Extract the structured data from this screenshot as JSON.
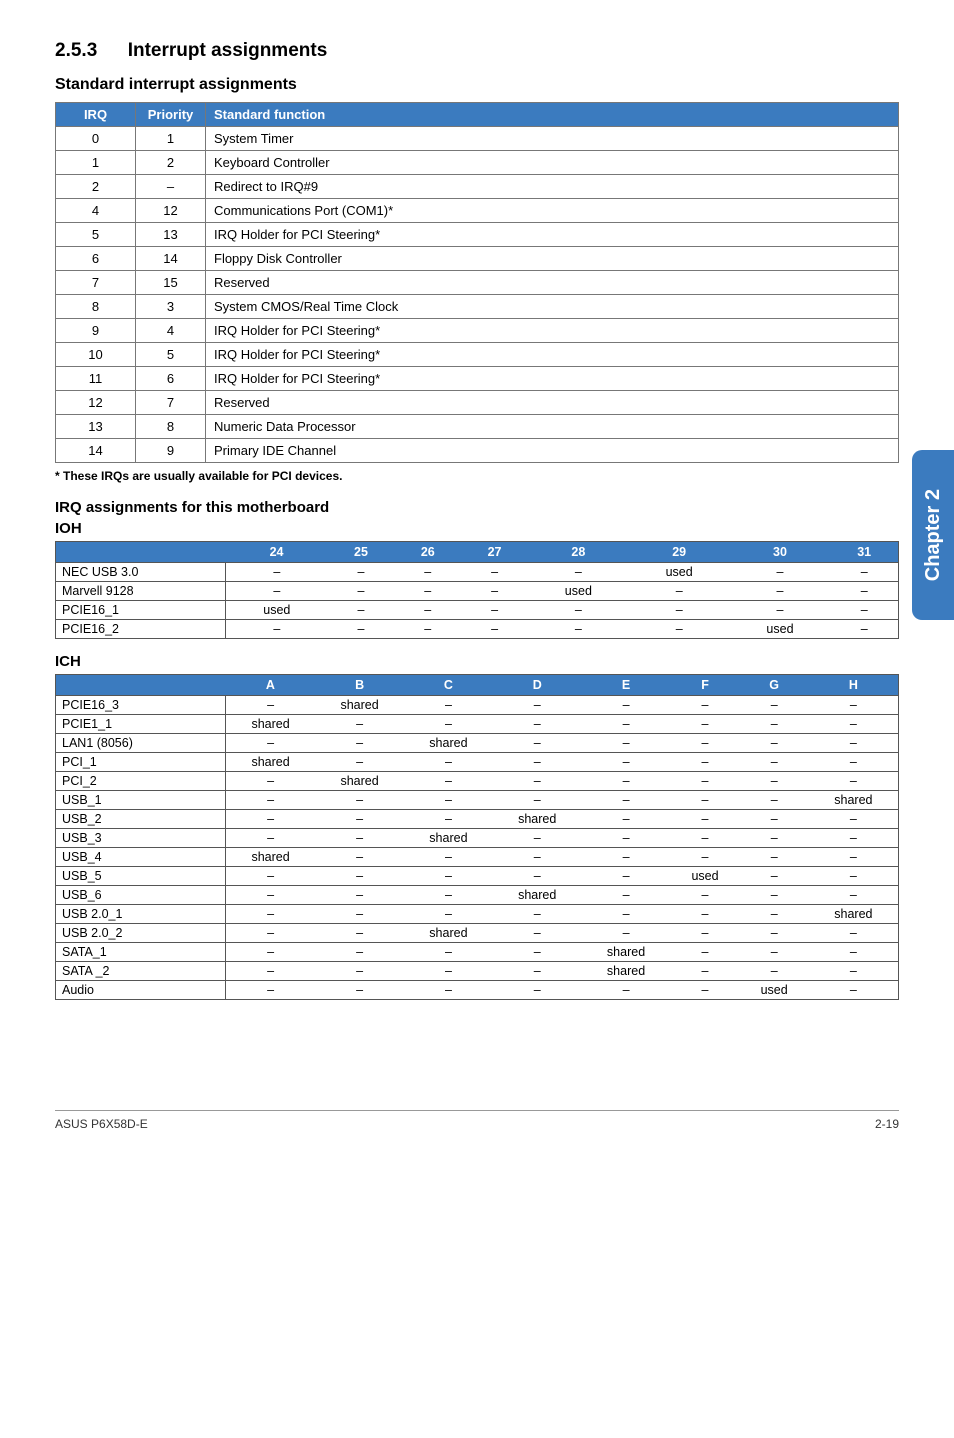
{
  "section": {
    "num": "2.5.3",
    "title": "Interrupt assignments"
  },
  "sub_standard": "Standard interrupt assignments",
  "irq_headers": {
    "c1": "IRQ",
    "c2": "Priority",
    "c3": "Standard function"
  },
  "irq_rows": [
    {
      "irq": "0",
      "pri": "1",
      "func": "System Timer"
    },
    {
      "irq": "1",
      "pri": "2",
      "func": "Keyboard Controller"
    },
    {
      "irq": "2",
      "pri": "–",
      "func": "Redirect to IRQ#9"
    },
    {
      "irq": "4",
      "pri": "12",
      "func": "Communications Port (COM1)*"
    },
    {
      "irq": "5",
      "pri": "13",
      "func": "IRQ Holder for PCI Steering*"
    },
    {
      "irq": "6",
      "pri": "14",
      "func": "Floppy Disk Controller"
    },
    {
      "irq": "7",
      "pri": "15",
      "func": "Reserved"
    },
    {
      "irq": "8",
      "pri": "3",
      "func": "System CMOS/Real Time Clock"
    },
    {
      "irq": "9",
      "pri": "4",
      "func": "IRQ Holder for PCI Steering*"
    },
    {
      "irq": "10",
      "pri": "5",
      "func": "IRQ Holder for PCI Steering*"
    },
    {
      "irq": "11",
      "pri": "6",
      "func": "IRQ Holder for PCI Steering*"
    },
    {
      "irq": "12",
      "pri": "7",
      "func": "Reserved"
    },
    {
      "irq": "13",
      "pri": "8",
      "func": "Numeric Data Processor"
    },
    {
      "irq": "14",
      "pri": "9",
      "func": "Primary IDE Channel"
    }
  ],
  "footnote": "* These IRQs are usually available for PCI devices.",
  "sub_irq_assign": "IRQ assignments for this motherboard",
  "ioh_label": "IOH",
  "ioh_headers": [
    "",
    "24",
    "25",
    "26",
    "27",
    "28",
    "29",
    "30",
    "31"
  ],
  "ioh_rows": [
    {
      "name": "NEC USB 3.0",
      "cells": [
        "–",
        "–",
        "–",
        "–",
        "–",
        "used",
        "–",
        "–"
      ]
    },
    {
      "name": "Marvell 9128",
      "cells": [
        "–",
        "–",
        "–",
        "–",
        "used",
        "–",
        "–",
        "–"
      ]
    },
    {
      "name": "PCIE16_1",
      "cells": [
        "used",
        "–",
        "–",
        "–",
        "–",
        "–",
        "–",
        "–"
      ]
    },
    {
      "name": "PCIE16_2",
      "cells": [
        "–",
        "–",
        "–",
        "–",
        "–",
        "–",
        "used",
        "–"
      ]
    }
  ],
  "ich_label": "ICH",
  "ich_headers": [
    "",
    "A",
    "B",
    "C",
    "D",
    "E",
    "F",
    "G",
    "H"
  ],
  "ich_rows": [
    {
      "name": "PCIE16_3",
      "cells": [
        "–",
        "shared",
        "–",
        "–",
        "–",
        "–",
        "–",
        "–"
      ]
    },
    {
      "name": "PCIE1_1",
      "cells": [
        "shared",
        "–",
        "–",
        "–",
        "–",
        "–",
        "–",
        "–"
      ]
    },
    {
      "name": "LAN1 (8056)",
      "cells": [
        "–",
        "–",
        "shared",
        "–",
        "–",
        "–",
        "–",
        "–"
      ]
    },
    {
      "name": "PCI_1",
      "cells": [
        "shared",
        "–",
        "–",
        "–",
        "–",
        "–",
        "–",
        "–"
      ]
    },
    {
      "name": "PCI_2",
      "cells": [
        "–",
        "shared",
        "–",
        "–",
        "–",
        "–",
        "–",
        "–"
      ]
    },
    {
      "name": "USB_1",
      "cells": [
        "–",
        "–",
        "–",
        "–",
        "–",
        "–",
        "–",
        "shared"
      ]
    },
    {
      "name": "USB_2",
      "cells": [
        "–",
        "–",
        "–",
        "shared",
        "–",
        "–",
        "–",
        "–"
      ]
    },
    {
      "name": "USB_3",
      "cells": [
        "–",
        "–",
        "shared",
        "–",
        "–",
        "–",
        "–",
        "–"
      ]
    },
    {
      "name": "USB_4",
      "cells": [
        "shared",
        "–",
        "–",
        "–",
        "–",
        "–",
        "–",
        "–"
      ]
    },
    {
      "name": "USB_5",
      "cells": [
        "–",
        "–",
        "–",
        "–",
        "–",
        "used",
        "–",
        "–"
      ]
    },
    {
      "name": "USB_6",
      "cells": [
        "–",
        "–",
        "–",
        "shared",
        "–",
        "–",
        "–",
        "–"
      ]
    },
    {
      "name": "USB 2.0_1",
      "cells": [
        "–",
        "–",
        "–",
        "–",
        "–",
        "–",
        "–",
        "shared"
      ]
    },
    {
      "name": "USB 2.0_2",
      "cells": [
        "–",
        "–",
        "shared",
        "–",
        "–",
        "–",
        "–",
        "–"
      ]
    },
    {
      "name": "SATA_1",
      "cells": [
        "–",
        "–",
        "–",
        "–",
        "shared",
        "–",
        "–",
        "–"
      ]
    },
    {
      "name": "SATA _2",
      "cells": [
        "–",
        "–",
        "–",
        "–",
        "shared",
        "–",
        "–",
        "–"
      ]
    },
    {
      "name": "Audio",
      "cells": [
        "–",
        "–",
        "–",
        "–",
        "–",
        "–",
        "used",
        "–"
      ]
    }
  ],
  "side_tab": "Chapter 2",
  "footer": {
    "left": "ASUS P6X58D-E",
    "right": "2-19"
  }
}
